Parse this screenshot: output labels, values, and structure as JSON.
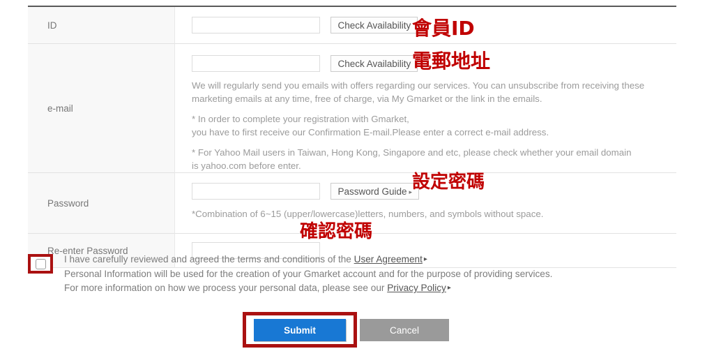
{
  "form": {
    "rows": [
      {
        "label": "ID",
        "button": "Check Availability",
        "annotation": "會員ID"
      },
      {
        "label": "e-mail",
        "button": "Check Availability",
        "annotation": "電郵地址",
        "desc1": "We will regularly send you emails with offers regarding our services. You can unsubscribe from receiving these marketing emails at any time, free of charge, via My Gmarket or the link in the emails.",
        "desc2_line1": "* In order to complete your registration with Gmarket,",
        "desc2_line2": "you have to first receive our Confirmation E-mail.Please enter a correct e-mail address.",
        "desc3_line1": "* For Yahoo Mail users in Taiwan, Hong Kong, Singapore and etc, please check whether your email domain",
        "desc3_line2": "is yahoo.com before enter."
      },
      {
        "label": "Password",
        "button": "Password Guide",
        "button_arrow": "▸",
        "annotation": "設定密碼",
        "note": "*Combination of 6~15 (upper/lowercase)letters, numbers, and symbols without space."
      },
      {
        "label": "Re-enter Password",
        "annotation": "確認密碼"
      }
    ]
  },
  "agreement": {
    "line1_before": "I have carefully reviewed and agreed the terms and conditions of the",
    "line1_link": "User Agreement",
    "line1_arrow": "▸",
    "line2": "Personal Information will be used for the creation of your Gmarket account and for the purpose of providing services.",
    "line3_before": "For more information on how we process your personal data, please see our",
    "line3_link": "Privacy Policy",
    "line3_arrow": "▸"
  },
  "actions": {
    "submit_label": "Submit",
    "cancel_label": "Cancel"
  },
  "colors": {
    "annotation_red": "#c00000",
    "highlight_red": "#aa1111",
    "submit_blue": "#1878d4",
    "cancel_gray": "#9a9a9a"
  }
}
